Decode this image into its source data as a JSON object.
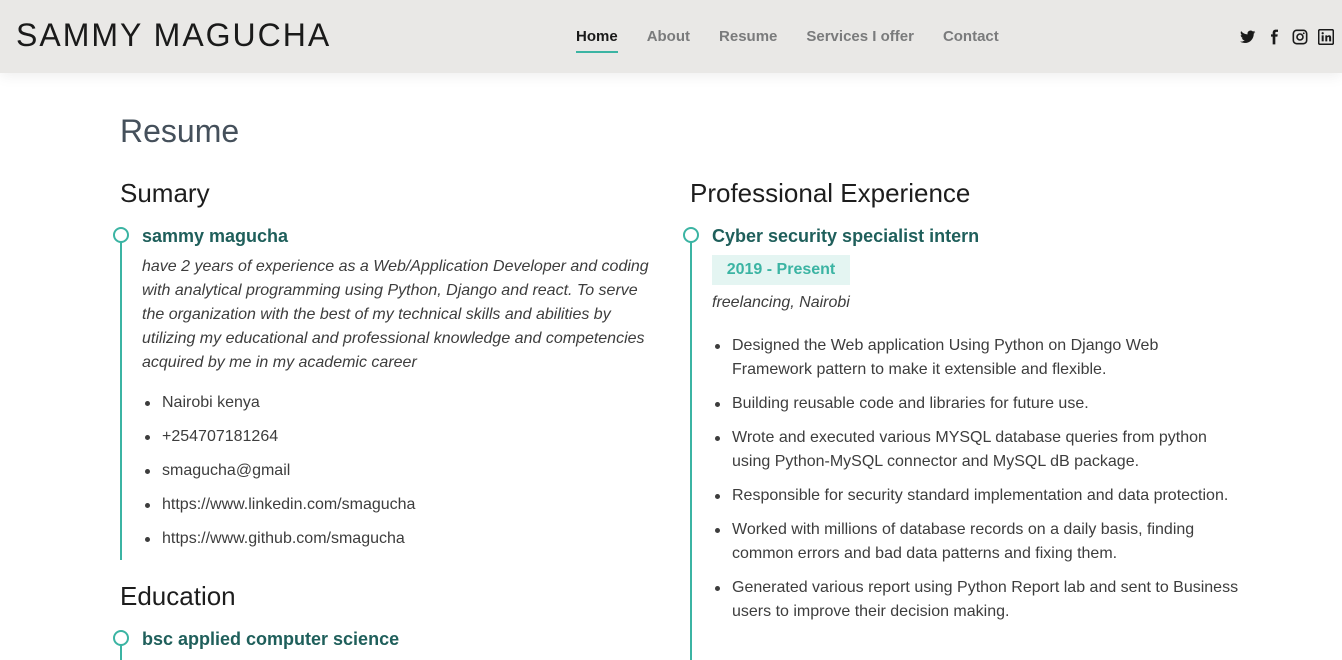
{
  "header": {
    "logo": "SAMMY MAGUCHA",
    "nav": [
      "Home",
      "About",
      "Resume",
      "Services I offer",
      "Contact"
    ],
    "active_nav": "Home",
    "socials": [
      "twitter-icon",
      "facebook-icon",
      "instagram-icon",
      "linkedin-icon"
    ]
  },
  "page": {
    "title": "Resume"
  },
  "summary": {
    "heading": "Sumary",
    "name": "sammy magucha",
    "description": "have 2 years of experience as a Web/Application Developer and coding with analytical programming using Python, Django and react. To serve the organization with the best of my technical skills and abilities by utilizing my educational and professional knowledge and competencies acquired by me in my academic career",
    "contacts": [
      "Nairobi kenya",
      "+254707181264",
      "smagucha@gmail",
      "https://www.linkedin.com/smagucha",
      "https://www.github.com/smagucha"
    ]
  },
  "education": {
    "heading": "Education",
    "items": [
      {
        "title": "bsc applied computer science"
      }
    ]
  },
  "experience": {
    "heading": "Professional Experience",
    "items": [
      {
        "title": "Cyber security specialist intern",
        "date": "2019 - Present",
        "place": "freelancing, Nairobi",
        "bullets": [
          "Designed the Web application Using Python on Django Web Framework pattern to make it extensible and flexible.",
          "Building reusable code and libraries for future use.",
          "Wrote and executed various MYSQL database queries from python using Python-MySQL connector and MySQL dB package.",
          "Responsible for security standard implementation and data protection.",
          "Worked with millions of database records on a daily basis, finding common errors and bad data patterns and fixing them.",
          "Generated various report using Python Report lab and sent to Business users to improve their decision making."
        ]
      }
    ]
  },
  "colors": {
    "accent": "#3bb4a3",
    "title": "#1f5f5b",
    "header_bg": "#e9e8e6"
  }
}
